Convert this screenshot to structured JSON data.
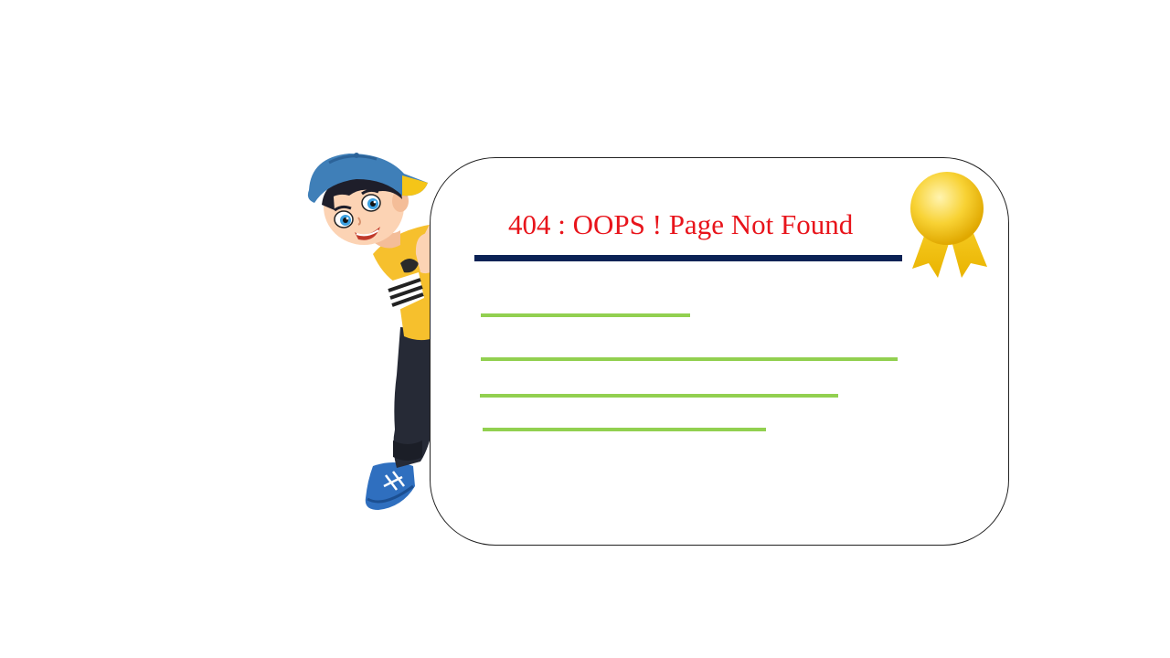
{
  "page": {
    "title": "404 : OOPS ! Page Not Found"
  },
  "text_lines": [
    {
      "kind": "placeholder-line"
    },
    {
      "kind": "placeholder-line"
    },
    {
      "kind": "placeholder-line"
    },
    {
      "kind": "placeholder-line"
    }
  ],
  "colors": {
    "title": "#e8141b",
    "title_rule": "#0b2255",
    "lines": "#92d050",
    "card_border": "#222222",
    "ribbon_gold": "#f5c518"
  },
  "illustrations": {
    "character": "boy-peeking-icon",
    "badge": "award-ribbon-icon"
  }
}
